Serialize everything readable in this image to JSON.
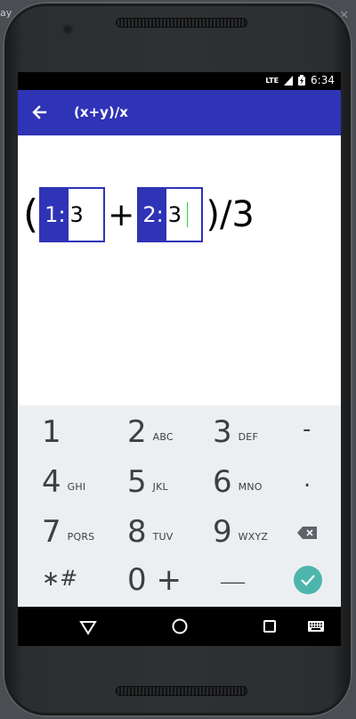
{
  "desktop": {
    "partial_text": "ay",
    "close_glyph": "✕"
  },
  "status_bar": {
    "network": "LTE",
    "time": "6:34"
  },
  "app_bar": {
    "title": "(x+y)/x"
  },
  "formula": {
    "open_paren": "(",
    "slot1": {
      "tag": "1:",
      "value": "3"
    },
    "operator": "+",
    "slot2": {
      "tag": "2:",
      "value": "3"
    },
    "tail": ")/3"
  },
  "keypad": {
    "rows": [
      [
        {
          "digit": "1",
          "letters": ""
        },
        {
          "digit": "2",
          "letters": "ABC"
        },
        {
          "digit": "3",
          "letters": "DEF"
        },
        {
          "digit": "-",
          "letters": ""
        }
      ],
      [
        {
          "digit": "4",
          "letters": "GHI"
        },
        {
          "digit": "5",
          "letters": "JKL"
        },
        {
          "digit": "6",
          "letters": "MNO"
        },
        {
          "digit": ".",
          "letters": ""
        }
      ],
      [
        {
          "digit": "7",
          "letters": "PQRS"
        },
        {
          "digit": "8",
          "letters": "TUV"
        },
        {
          "digit": "9",
          "letters": "WXYZ"
        },
        {
          "digit": "",
          "letters": "backspace"
        }
      ],
      [
        {
          "digit": "∗#",
          "letters": ""
        },
        {
          "digit": "0 +",
          "letters": ""
        },
        {
          "digit": "___",
          "letters": ""
        },
        {
          "digit": "",
          "letters": "done"
        }
      ]
    ],
    "accent_done": "#4db6ac"
  },
  "colors": {
    "primary": "#2f33b6",
    "cursor": "#2ecc40"
  }
}
